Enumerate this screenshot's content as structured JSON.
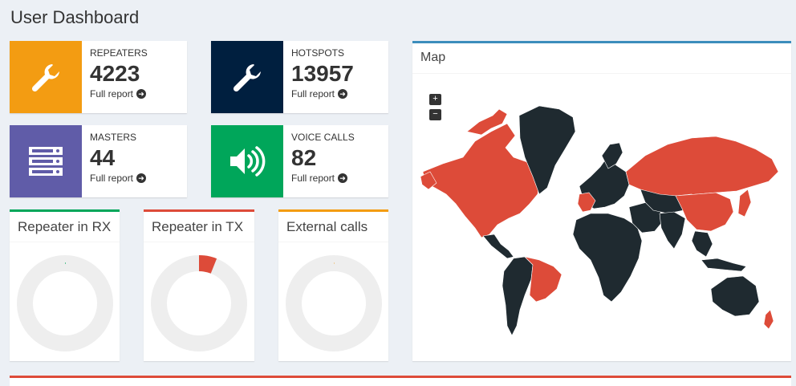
{
  "page": {
    "title": "User Dashboard"
  },
  "infoboxes": [
    {
      "label": "REPEATERS",
      "value": "4223",
      "link": "Full report",
      "color": "#f39c12",
      "icon": "wrench-icon"
    },
    {
      "label": "HOTSPOTS",
      "value": "13957",
      "link": "Full report",
      "color": "#001f3f",
      "icon": "wrench-icon"
    },
    {
      "label": "MASTERS",
      "value": "44",
      "link": "Full report",
      "color": "#605ca8",
      "icon": "server-icon"
    },
    {
      "label": "VOICE CALLS",
      "value": "82",
      "link": "Full report",
      "color": "#00a65a",
      "icon": "volume-icon"
    }
  ],
  "panels": {
    "rx": {
      "title": "Repeater in RX",
      "color": "#00a65a",
      "fraction": 0.003
    },
    "tx": {
      "title": "Repeater in TX",
      "color": "#dd4b39",
      "fraction": 0.06
    },
    "ext": {
      "title": "External calls",
      "color": "#f39c12",
      "fraction": 0.002
    }
  },
  "map": {
    "title": "Map",
    "accent": "#3c8dbc",
    "zoom_in": "+",
    "zoom_out": "−",
    "active_color": "#dd4b39",
    "inactive_color": "#1f2a30"
  },
  "colors": {
    "bottom_box": "#dd4b39"
  }
}
